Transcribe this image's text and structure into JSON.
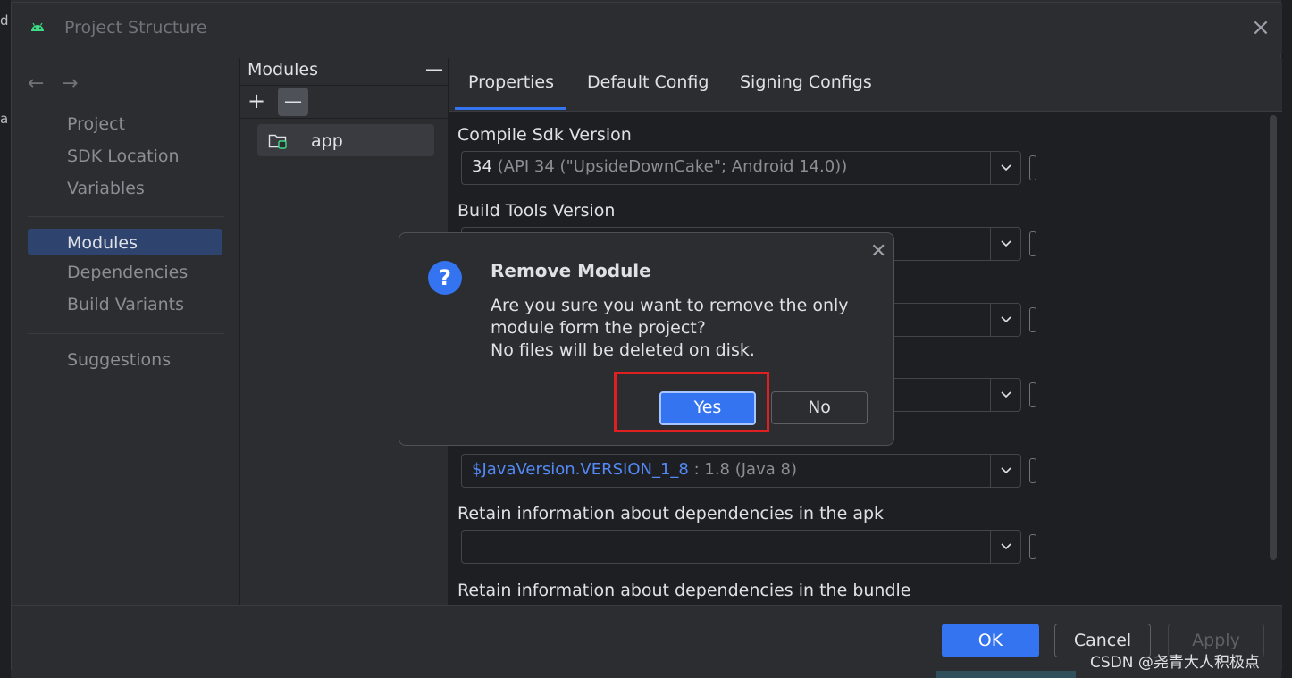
{
  "window": {
    "title": "Project Structure"
  },
  "nav": {
    "back_glyph": "←",
    "forward_glyph": "→",
    "items": [
      "Project",
      "SDK Location",
      "Variables",
      "Modules",
      "Dependencies",
      "Build Variants",
      "Suggestions"
    ],
    "selected": "Modules"
  },
  "modules_panel": {
    "header": "Modules",
    "collapse_glyph": "—",
    "add_glyph": "+",
    "remove_glyph": "—",
    "items": [
      "app"
    ]
  },
  "tabs": [
    "Properties",
    "Default Config",
    "Signing Configs"
  ],
  "fields": {
    "compile_sdk": {
      "label": "Compile Sdk Version",
      "value": "34",
      "hint": "(API 34 (\"UpsideDownCake\"; Android 14.0))"
    },
    "build_tools": {
      "label": "Build Tools Version"
    },
    "java_version": {
      "value": "$JavaVersion.VERSION_1_8",
      "hint": ": 1.8 (Java 8)"
    },
    "deps_apk": {
      "label": "Retain information about dependencies in the apk"
    },
    "deps_bundle": {
      "label": "Retain information about dependencies in the bundle"
    }
  },
  "footer": {
    "ok": "OK",
    "cancel": "Cancel",
    "apply": "Apply"
  },
  "dialog": {
    "title": "Remove Module",
    "lines": [
      "Are you sure you want to remove the only",
      "module form the project?",
      "No files will be deleted on disk."
    ],
    "yes": "Yes",
    "no": "No",
    "close_glyph": "✕",
    "icon_glyph": "?"
  },
  "watermark": "CSDN @尧青大人积极点",
  "colors": {
    "accent": "#3574f0",
    "highlight": "#e02020",
    "link": "#548af7"
  }
}
